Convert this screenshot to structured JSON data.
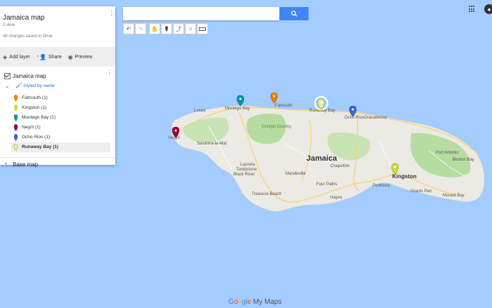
{
  "map": {
    "island_label": "Jamaica",
    "place_labels": [
      {
        "key": "lucea",
        "text": "Lucea"
      },
      {
        "key": "montego_map",
        "text": "Montego Bay"
      },
      {
        "key": "falmouth_map",
        "text": "Falmouth"
      },
      {
        "key": "runaway_map",
        "text": "Runaway Bay"
      },
      {
        "key": "ocho_map",
        "text": "Ocho Rios"
      },
      {
        "key": "oracabessa",
        "text": "Oracabessa"
      },
      {
        "key": "negril_map",
        "text": "Negril"
      },
      {
        "key": "savanna",
        "text": "Savanna-la-Mar"
      },
      {
        "key": "lacovia",
        "text": "Lacovia"
      },
      {
        "key": "tombstone",
        "text": "Tombstone"
      },
      {
        "key": "black_river",
        "text": "Black River"
      },
      {
        "key": "mandeville",
        "text": "Mandeville"
      },
      {
        "key": "treasure",
        "text": "Treasure Beach"
      },
      {
        "key": "four_paths",
        "text": "Four Paths"
      },
      {
        "key": "hayes",
        "text": "Hayes"
      },
      {
        "key": "portmore",
        "text": "Portmore"
      },
      {
        "key": "kingston_map",
        "text": "Kingston"
      },
      {
        "key": "cockpit",
        "text": "Cockpit Country"
      },
      {
        "key": "port_antonio",
        "text": "Port Antonio"
      },
      {
        "key": "boston_bay",
        "text": "Boston Bay"
      },
      {
        "key": "morant_bay",
        "text": "Morant Bay"
      },
      {
        "key": "grants_pen",
        "text": "Grants Pen"
      },
      {
        "key": "chapelton",
        "text": "Chapelton"
      }
    ]
  },
  "panel": {
    "title": "Jamaica map",
    "views": "1 view",
    "saved": "All changes saved in Drive",
    "actions": {
      "add_layer": "Add layer",
      "share": "Share",
      "preview": "Preview"
    },
    "layer": {
      "name": "Jamaica map",
      "styled_by": "Styled by name",
      "items": [
        {
          "name": "Falmouth (1)",
          "color": "#f57c00"
        },
        {
          "name": "Kingston (1)",
          "color": "#cddc39"
        },
        {
          "name": "Montego Bay (1)",
          "color": "#0097a7"
        },
        {
          "name": "Negril (1)",
          "color": "#a0003d"
        },
        {
          "name": "Ocho Rios (1)",
          "color": "#3367d6"
        },
        {
          "name": "Runaway Bay (1)",
          "color": "#e6ee9c",
          "selected": true
        }
      ]
    },
    "base_map": "Base map"
  },
  "search": {
    "placeholder": ""
  },
  "footer": {
    "brand_google": "Google",
    "brand_suffix": "My Maps"
  },
  "colors": {
    "water": "#a3ccff",
    "land": "#eceae4",
    "green": "#b6dca1",
    "accent": "#4285f4"
  }
}
